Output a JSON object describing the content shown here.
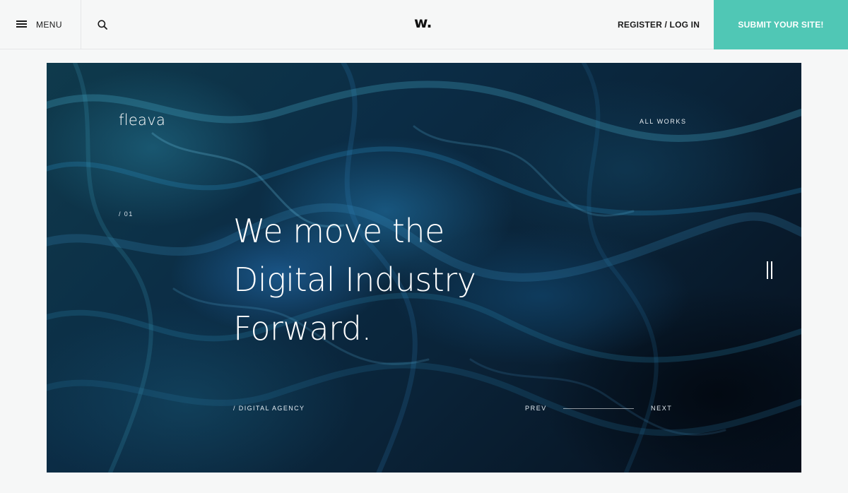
{
  "header": {
    "menu_label": "MENU",
    "logo_text": "w.",
    "auth_label": "REGISTER / LOG IN",
    "submit_label": "SUBMIT YOUR SITE!",
    "accent_color": "#50c7b5"
  },
  "hero": {
    "brand": "fleava",
    "all_works_label": "ALL WORKS",
    "slide_number": "/ 01",
    "headline_lines": [
      "We move the",
      "Digital Industry",
      "Forward."
    ],
    "tagline": "/ DIGITAL AGENCY",
    "prev_label": "PREV",
    "next_label": "NEXT"
  },
  "icons": {
    "menu": "hamburger-icon",
    "search": "search-icon",
    "pause": "pause-icon"
  }
}
